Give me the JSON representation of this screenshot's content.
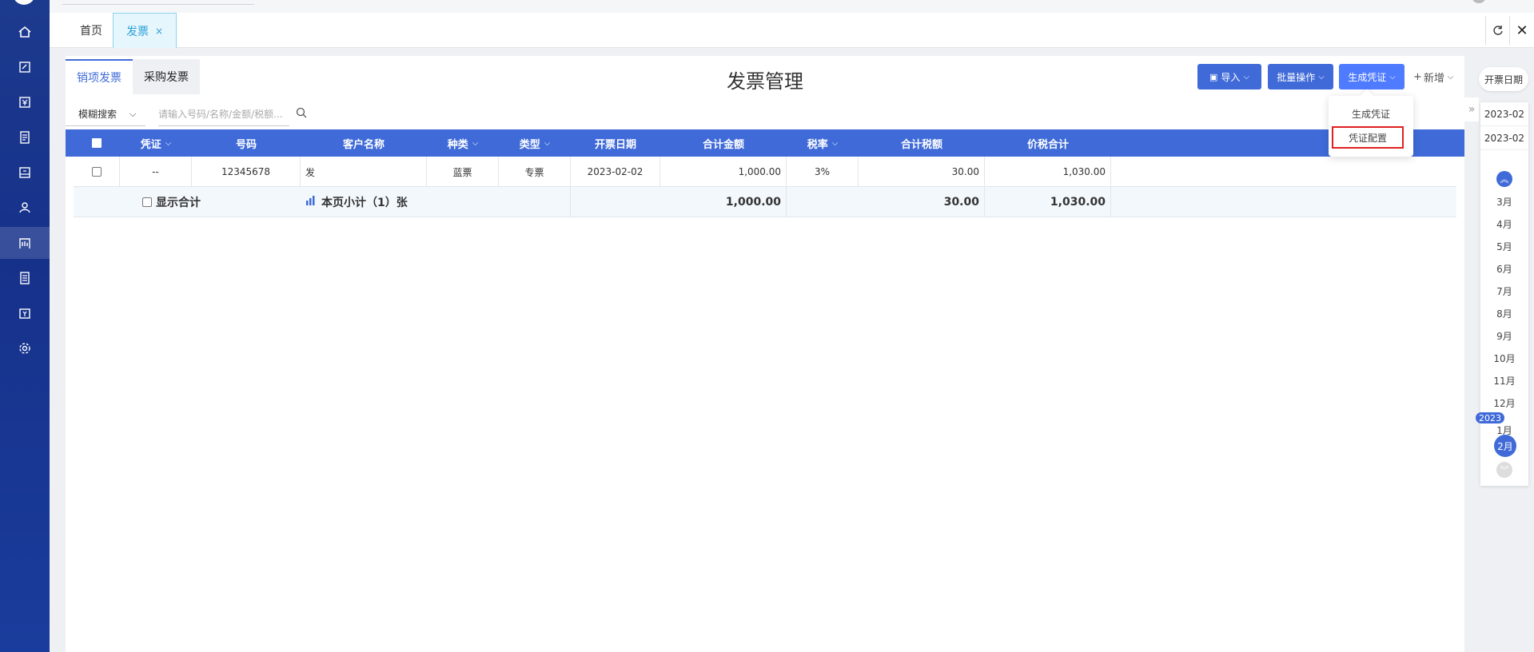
{
  "tabs": {
    "home": "首页",
    "invoice": "发票",
    "close": "×"
  },
  "title": "发票管理",
  "subtabs": {
    "sales": "销项发票",
    "purchase": "采购发票"
  },
  "toolbar": {
    "import": "导入",
    "batch": "批量操作",
    "voucher": "生成凭证",
    "add": "新增"
  },
  "dropdown": {
    "generate": "生成凭证",
    "config": "凭证配置"
  },
  "search": {
    "mode": "模糊搜索",
    "placeholder": "请输入号码/名称/金额/税额..."
  },
  "columns": {
    "voucher": "凭证",
    "number": "号码",
    "customer": "客户名称",
    "kind": "种类",
    "type": "类型",
    "date": "开票日期",
    "amount": "合计金额",
    "rate": "税率",
    "tax": "合计税额",
    "total": "价税合计"
  },
  "rows": [
    {
      "voucher": "--",
      "number": "12345678",
      "customer": "发",
      "kind": "蓝票",
      "type": "专票",
      "date": "2023-02-02",
      "amount": "1,000.00",
      "rate": "3%",
      "tax": "30.00",
      "total": "1,030.00"
    }
  ],
  "summary": {
    "show_total": "显示合计",
    "subtotal": "本页小计（1）张",
    "amount": "1,000.00",
    "tax": "30.00",
    "total": "1,030.00"
  },
  "date_rail": {
    "header": "开票日期",
    "ranges": [
      "2023-02",
      "2023-02"
    ],
    "months": [
      "3月",
      "4月",
      "5月",
      "6月",
      "7月",
      "8月",
      "9月",
      "10月",
      "11月",
      "12月",
      "1月"
    ],
    "year": "2023",
    "selected": "2月"
  },
  "colors": {
    "primary": "#3f6ad8",
    "sidebar": "#1c3a8e",
    "highlight": "#e02020"
  }
}
